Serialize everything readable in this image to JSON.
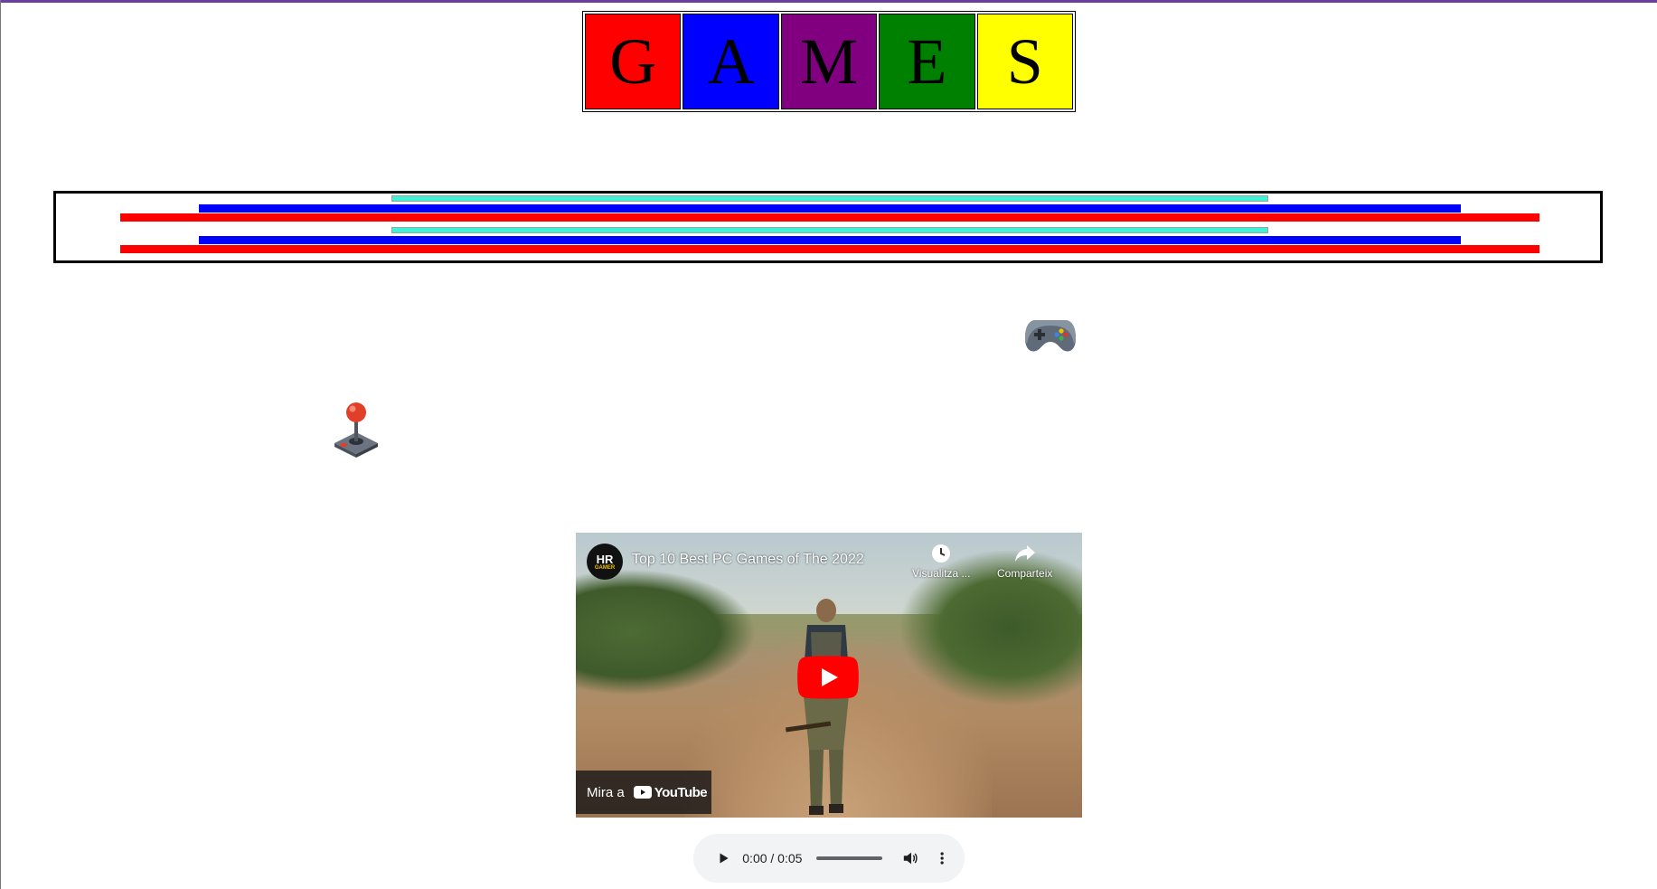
{
  "title": {
    "letters": [
      "G",
      "A",
      "M",
      "E",
      "S"
    ],
    "colors": [
      "#ff0000",
      "#0000ff",
      "#800080",
      "#008000",
      "#ffff00"
    ]
  },
  "stripes": {
    "colors": {
      "cyan": "#3ef2d6",
      "blue": "#0000ff",
      "red": "#ff0000"
    }
  },
  "icons": {
    "gamepad": "gamepad-icon",
    "joystick": "joystick-icon"
  },
  "video": {
    "channel_avatar_text": "HR",
    "channel_avatar_sub": "GAMER",
    "title": "Top 10 Best PC Games of The 2022",
    "watch_later_label": "Visualitza ...",
    "share_label": "Comparteix",
    "watch_on_label": "Mira a",
    "youtube_label": "YouTube"
  },
  "audio": {
    "time": "0:00 / 0:05",
    "progress": 0
  }
}
